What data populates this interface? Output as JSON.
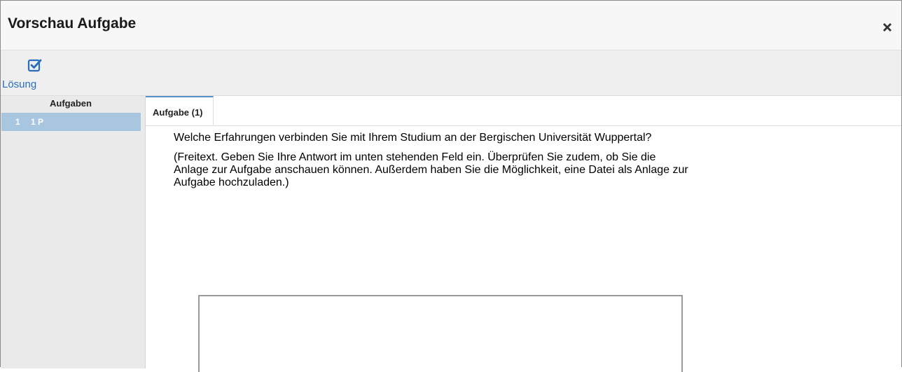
{
  "dialog": {
    "title": "Vorschau Aufgabe",
    "close_icon": "close-x-icon"
  },
  "toolbar": {
    "solution_label": "Lösung",
    "solution_icon": "checkbox-checked-icon"
  },
  "sidebar": {
    "header": "Aufgaben",
    "items": [
      {
        "number": "1",
        "points": "1 P"
      }
    ]
  },
  "tabs": [
    {
      "label": "Aufgabe (1)",
      "active": true
    }
  ],
  "question": {
    "text": "Welche Erfahrungen verbinden Sie mit Ihrem Studium an der Bergischen Universität Wuppertal?",
    "instructions": "(Freitext. Geben Sie Ihre Antwort im unten stehenden Feld ein. Überprüfen Sie zudem, ob Sie die Anlage zur Aufgabe anschauen können. Außerdem haben Sie die Möglichkeit, eine Datei als Anlage zur Aufgabe hochzuladen.)"
  },
  "answer": {
    "value": ""
  },
  "colors": {
    "accent": "#2a6ebb",
    "selected_item": "#a9c6e0",
    "tab_border": "#5b8fc7"
  }
}
